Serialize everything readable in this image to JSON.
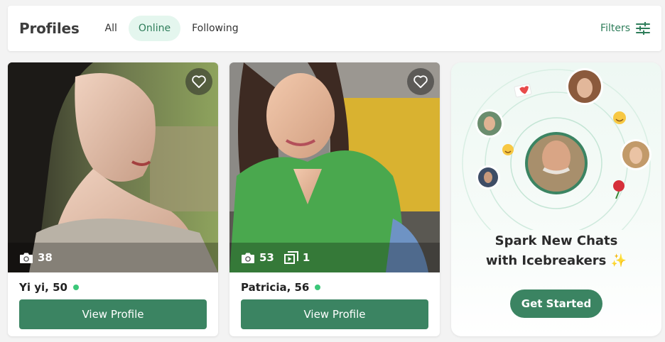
{
  "header": {
    "title": "Profiles",
    "tabs": [
      {
        "label": "All",
        "active": false
      },
      {
        "label": "Online",
        "active": true
      },
      {
        "label": "Following",
        "active": false
      }
    ],
    "filters_label": "Filters",
    "filters_icon": "sliders-icon"
  },
  "profiles": [
    {
      "name_age": "Yi yi, 50",
      "photos": "38",
      "videos": null,
      "online": true,
      "button": "View Profile"
    },
    {
      "name_age": "Patricia, 56",
      "photos": "53",
      "videos": "1",
      "online": true,
      "button": "View Profile"
    }
  ],
  "promo": {
    "line1": "Spark New Chats",
    "line2": "with Icebreakers ✨",
    "button": "Get Started"
  },
  "colors": {
    "accent": "#3b8462",
    "online": "#3cc779",
    "active_tab_bg": "#e4f6ee"
  }
}
